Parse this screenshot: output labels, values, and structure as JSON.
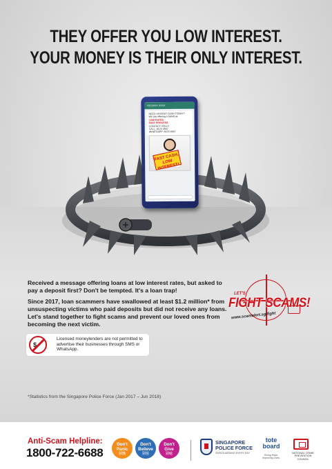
{
  "headline": {
    "line1": "THEY OFFER YOU LOW INTEREST.",
    "line2": "YOUR MONEY IS THEIR ONLY INTEREST."
  },
  "phone": {
    "chat_title": "+65 8XXX XXXX",
    "msg_line1": "NEED URGENT CASH TODAY?",
    "msg_line2": "We are offering LOANS at:",
    "msg_point1": "LOW RATES",
    "msg_point2": "FAST PROCESS",
    "msg_contact": "CONTACT: KELLY",
    "msg_call": "CALL: 8123 4567",
    "msg_whatsapp": "WHATSAPP: 8123 4567",
    "ad_stamp": "FAST CASH, LOW INTEREST!"
  },
  "body_copy": {
    "paragraph1": "Received a message offering loans at low interest rates, but asked to pay a deposit first? Don't be tempted. It's a loan trap!",
    "paragraph2": "Since 2017, loan scammers have swallowed at least $1.2 million* from unsuspecting victims who paid deposits but did not receive any loans. Let's stand together to fight scams and prevent our loved ones from becoming the next victim."
  },
  "campaign": {
    "lets": "LET'S",
    "title": "FIGHT SCAMS!",
    "url": "www.scamalert.sg/fight",
    "accent_color": "#d0121b"
  },
  "notice": {
    "icon_symbol": "$",
    "text": "Licensed moneylenders are not permitted to advertise their businesses through SMS or WhatsApp."
  },
  "footnote": "*Statistics from the Singapore Police Force (Jan 2017 – Jun 2018)",
  "footer": {
    "helpline_label": "Anti-Scam Helpline:",
    "helpline_number": "1800-722-6688",
    "badges": [
      {
        "en": "Don't Panic",
        "zh": "别慌",
        "color": "#f28c1c"
      },
      {
        "en": "Don't Believe",
        "zh": "别信",
        "color": "#2f6db5"
      },
      {
        "en": "Don't Give",
        "zh": "别给",
        "color": "#c2208c"
      }
    ],
    "spf_name_line1": "SINGAPORE",
    "spf_name_line2": "POLICE FORCE",
    "spf_tagline": "SAFEGUARDING EVERY DAY",
    "tote_line1": "tote",
    "tote_line2": "board",
    "tote_tagline": "Giving Hope. Improving Lives.",
    "ncpc_name": "NATIONAL CRIME PREVENTION COUNCIL"
  }
}
